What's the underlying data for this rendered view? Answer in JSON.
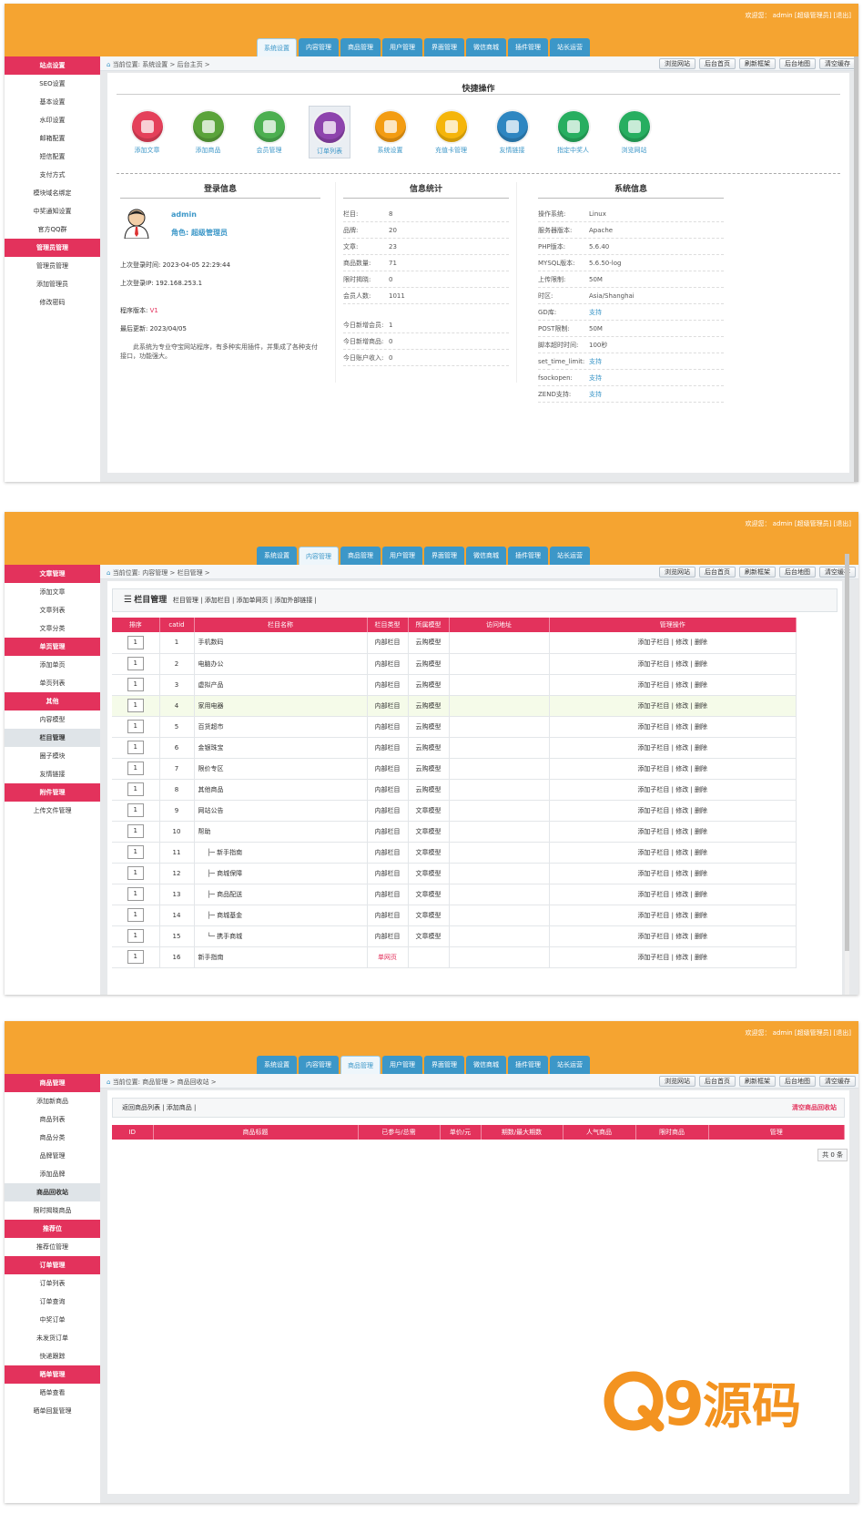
{
  "header": {
    "welcome": "欢迎您： admin [超级管理员] [退出]",
    "tabs": [
      "系统设置",
      "内容管理",
      "商品管理",
      "用户管理",
      "界面管理",
      "微信商城",
      "插件管理",
      "站长运营"
    ]
  },
  "toolbar": {
    "buttons": [
      "浏览网站",
      "后台首页",
      "刷新框架",
      "后台地图",
      "清空缓存"
    ]
  },
  "s1": {
    "breadcrumb": "当前位置: 系统设置 > 后台主页 >",
    "side": [
      [
        "h",
        "站点设置"
      ],
      [
        "i",
        "SEO设置"
      ],
      [
        "i",
        "基本设置"
      ],
      [
        "i",
        "水印设置"
      ],
      [
        "i",
        "邮箱配置"
      ],
      [
        "i",
        "短信配置"
      ],
      [
        "i",
        "支付方式"
      ],
      [
        "i",
        "模块域名绑定"
      ],
      [
        "i",
        "中奖通知设置"
      ],
      [
        "i",
        "官方QQ群"
      ],
      [
        "h",
        "管理员管理"
      ],
      [
        "i",
        "管理员管理"
      ],
      [
        "i",
        "添加管理员"
      ],
      [
        "i",
        "修改密码"
      ]
    ],
    "quick_title": "快捷操作",
    "quick": [
      {
        "label": "添加文章",
        "icon": "article-icon",
        "color": "#e4405a"
      },
      {
        "label": "添加商品",
        "icon": "sunflower-icon",
        "color": "#5aa33a"
      },
      {
        "label": "会员管理",
        "icon": "users-icon",
        "color": "#4caf50"
      },
      {
        "label": "订单列表",
        "icon": "order-icon",
        "color": "#8e44ad"
      },
      {
        "label": "系统设置",
        "icon": "gear-icon",
        "color": "#f39c12"
      },
      {
        "label": "充值卡管理",
        "icon": "coin-icon",
        "color": "#f5b50a"
      },
      {
        "label": "友情链接",
        "icon": "globe-icon",
        "color": "#2e86c1"
      },
      {
        "label": "指定中奖人",
        "icon": "person-icon",
        "color": "#27ae60"
      },
      {
        "label": "浏览网站",
        "icon": "house-icon",
        "color": "#27ae60"
      }
    ],
    "login": {
      "title": "登录信息",
      "user": "admin",
      "role": "角色: 超级管理员",
      "last_time": "上次登录时间: 2023-04-05 22:29:44",
      "last_ip": "上次登录IP: 192.168.253.1",
      "version_label": "程序版本: ",
      "version": "V1",
      "updated": "最后更新: 2023/04/05",
      "desc": "此系统为专业夺宝网站程序，有多种实用插件，并集成了各种支付接口，功能强大。"
    },
    "stats": {
      "title": "信息统计",
      "rows": [
        [
          "栏目:",
          "8"
        ],
        [
          "品牌:",
          "20"
        ],
        [
          "文章:",
          "23"
        ],
        [
          "商品数量:",
          "71"
        ],
        [
          "限时揭晓:",
          "0"
        ],
        [
          "会员人数:",
          "1011"
        ]
      ],
      "today": [
        [
          "今日新增会员:",
          "1"
        ],
        [
          "今日新增商品:",
          "0"
        ],
        [
          "今日账户收入:",
          "0"
        ]
      ]
    },
    "sys": {
      "title": "系统信息",
      "rows": [
        [
          "操作系统:",
          "Linux"
        ],
        [
          "服务器版本:",
          "Apache"
        ],
        [
          "PHP版本:",
          "5.6.40"
        ],
        [
          "MYSQL版本:",
          "5.6.50-log"
        ],
        [
          "上传限制:",
          "50M"
        ],
        [
          "时区:",
          "Asia/Shanghai"
        ],
        [
          "GD库:",
          "支持"
        ],
        [
          "POST限制:",
          "50M"
        ],
        [
          "脚本超时时间:",
          "100秒"
        ],
        [
          "set_time_limit:",
          "支持"
        ],
        [
          "fsockopen:",
          "支持"
        ],
        [
          "ZEND支持:",
          "支持"
        ]
      ]
    }
  },
  "s2": {
    "breadcrumb": "当前位置: 内容管理 > 栏目管理 >",
    "side": [
      [
        "h",
        "文章管理"
      ],
      [
        "i",
        "添加文章"
      ],
      [
        "i",
        "文章列表"
      ],
      [
        "i",
        "文章分类"
      ],
      [
        "h",
        "单页管理"
      ],
      [
        "i",
        "添加单页"
      ],
      [
        "i",
        "单页列表"
      ],
      [
        "h",
        "其他"
      ],
      [
        "i",
        "内容模型"
      ],
      [
        "c",
        "栏目管理"
      ],
      [
        "i",
        "圈子模块"
      ],
      [
        "i",
        "友情链接"
      ],
      [
        "h",
        "附件管理"
      ],
      [
        "i",
        "上传文件管理"
      ]
    ],
    "bar_title": "栏目管理",
    "bar_links": "栏目管理 | 添加栏目 | 添加单网页 | 添加外部链接 |",
    "cols": [
      "排序",
      "catid",
      "栏目名称",
      "栏目类型",
      "所属模型",
      "访问地址",
      "管理操作"
    ],
    "ops": "添加子栏目 | 修改 | 删除",
    "rows": [
      [
        "1",
        "1",
        "手机数码",
        "内部栏目",
        "云购模型"
      ],
      [
        "1",
        "2",
        "电脑办公",
        "内部栏目",
        "云购模型"
      ],
      [
        "1",
        "3",
        "虚拟产品",
        "内部栏目",
        "云购模型"
      ],
      [
        "1",
        "4",
        "家用电器",
        "内部栏目",
        "云购模型"
      ],
      [
        "1",
        "5",
        "百货超市",
        "内部栏目",
        "云购模型"
      ],
      [
        "1",
        "6",
        "金银珠宝",
        "内部栏目",
        "云购模型"
      ],
      [
        "1",
        "7",
        "限价专区",
        "内部栏目",
        "云购模型"
      ],
      [
        "1",
        "8",
        "其他商品",
        "内部栏目",
        "云购模型"
      ],
      [
        "1",
        "9",
        "网站公告",
        "内部栏目",
        "文章模型"
      ],
      [
        "1",
        "10",
        "帮助",
        "内部栏目",
        "文章模型"
      ],
      [
        "1",
        "11",
        "├─ 新手指南",
        "内部栏目",
        "文章模型"
      ],
      [
        "1",
        "12",
        "├─ 商城保障",
        "内部栏目",
        "文章模型"
      ],
      [
        "1",
        "13",
        "├─ 商品配送",
        "内部栏目",
        "文章模型"
      ],
      [
        "1",
        "14",
        "├─ 商城基金",
        "内部栏目",
        "文章模型"
      ],
      [
        "1",
        "15",
        "└─ 携手商城",
        "内部栏目",
        "文章模型"
      ],
      [
        "1",
        "16",
        "新手指南",
        "单网页",
        ""
      ]
    ]
  },
  "s3": {
    "breadcrumb": "当前位置: 商品管理 > 商品回收站 >",
    "side": [
      [
        "h",
        "商品管理"
      ],
      [
        "i",
        "添加新商品"
      ],
      [
        "i",
        "商品列表"
      ],
      [
        "i",
        "商品分类"
      ],
      [
        "i",
        "品牌管理"
      ],
      [
        "i",
        "添加品牌"
      ],
      [
        "c",
        "商品回收站"
      ],
      [
        "i",
        "限时揭晓商品"
      ],
      [
        "h",
        "推荐位"
      ],
      [
        "i",
        "推荐位管理"
      ],
      [
        "h",
        "订单管理"
      ],
      [
        "i",
        "订单列表"
      ],
      [
        "i",
        "订单查询"
      ],
      [
        "i",
        "中奖订单"
      ],
      [
        "i",
        "未发货订单"
      ],
      [
        "i",
        "快递跟踪"
      ],
      [
        "h",
        "晒单管理"
      ],
      [
        "i",
        "晒单查看"
      ],
      [
        "i",
        "晒单回复管理"
      ]
    ],
    "bar_links": "返回商品列表 | 添加商品 |",
    "clear": "清空商品回收站",
    "cols": [
      "ID",
      "商品标题",
      "已参与/总需",
      "单价/元",
      "期数/最大期数",
      "人气商品",
      "限时商品",
      "管理"
    ],
    "total": "共 0 条"
  },
  "watermark": "Q9源码"
}
